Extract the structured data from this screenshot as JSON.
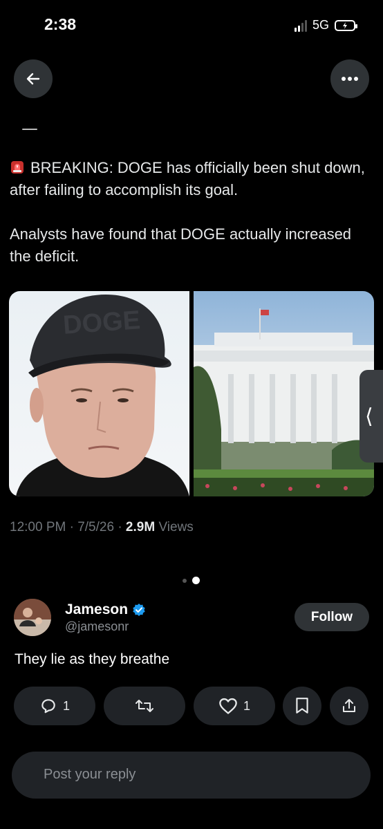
{
  "status_bar": {
    "time": "2:38",
    "network": "5G"
  },
  "header": {
    "back_icon": "arrow-left-icon",
    "more_icon": "more-horizontal-icon"
  },
  "tweet": {
    "line1": "BREAKING: DOGE has officially been shut down, after failing to accomplish its goal.",
    "line2": "Analysts have found that DOGE actually increased the deficit.",
    "cap_text": "DOGE",
    "timestamp": "12:00 PM · 7/5/26 · ",
    "views_count": "2.9M",
    "views_label": " Views"
  },
  "reply": {
    "name": "Jameson",
    "handle": "@jamesonr",
    "follow_label": "Follow",
    "text": "They lie as they breathe",
    "replies": "1",
    "likes": "1"
  },
  "composer": {
    "placeholder": "Post your reply"
  },
  "colors": {
    "background": "#000000",
    "pill": "#202327",
    "verified": "#1d9bf0"
  }
}
